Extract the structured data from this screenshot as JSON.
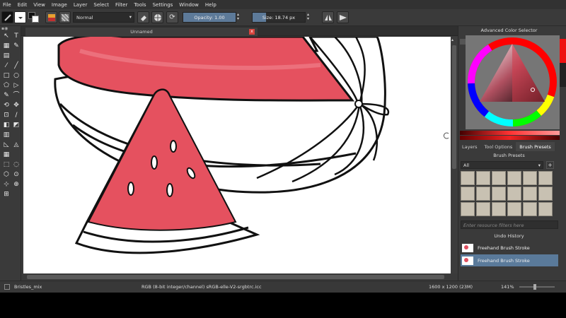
{
  "menu": [
    "File",
    "Edit",
    "View",
    "Image",
    "Layer",
    "Select",
    "Filter",
    "Tools",
    "Settings",
    "Window",
    "Help"
  ],
  "toolbar": {
    "blend_mode": "Normal",
    "opacity_label": "Opacity:  1.00",
    "opacity_value": 1.0,
    "size_label": "Size:  18.74 px",
    "size_fraction": 0.25,
    "fg_color": "#111111",
    "bg_color": "#ffffff",
    "accent": "#d8453e"
  },
  "document": {
    "tab_title": "Unnamed",
    "close_glyph": "x"
  },
  "toolbox": {
    "rows": [
      [
        "↖",
        "T"
      ],
      [
        "▦",
        "✎"
      ],
      [
        "▤",
        ""
      ],
      [
        "⁄",
        "╱"
      ],
      [
        "□",
        "○"
      ],
      [
        "⬠",
        "▷"
      ],
      [
        "✎",
        "⌒"
      ],
      [
        "⟲",
        "✥"
      ],
      [
        "⊡",
        "∕"
      ],
      [
        "◧",
        "◩"
      ],
      [
        "▥",
        ""
      ],
      [
        "◺",
        "◬"
      ],
      [
        "▦",
        ""
      ],
      [
        "⬚",
        "◌"
      ],
      [
        "⬡",
        "⊙"
      ],
      [
        "⊹",
        "⊕"
      ],
      [
        "⊞",
        ""
      ]
    ]
  },
  "docker": {
    "color_selector_title": "Advanced Color Selector",
    "tabs": [
      "Layers",
      "Tool Options",
      "Brush Presets"
    ],
    "brush_presets_title": "Brush Presets",
    "brush_tag": "All",
    "filter_placeholder": "Enter resource filters here",
    "undo_title": "Undo History",
    "history": [
      "Freehand Brush Stroke",
      "Freehand Brush Stroke"
    ]
  },
  "status": {
    "brush": "Bristles_mix",
    "colorspace": "RGB (8-bit integer/channel)  sRGB-elle-V2-srgbtrc.icc",
    "dimensions": "1600 x 1200 (23M)",
    "zoom": "141%"
  }
}
